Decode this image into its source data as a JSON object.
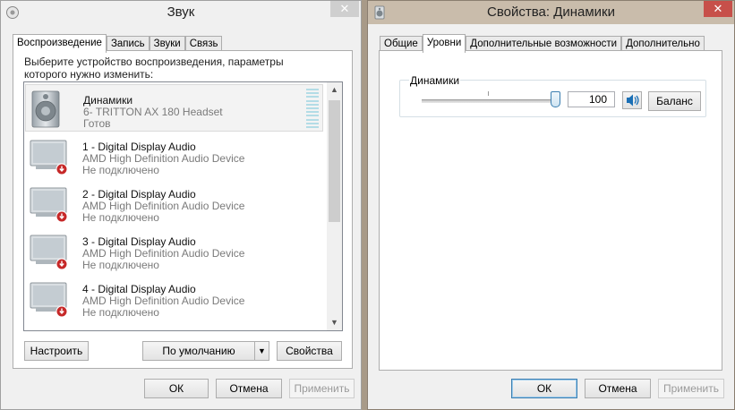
{
  "sound_window": {
    "title": "Звук",
    "close_glyph": "✕",
    "tabs": [
      {
        "label": "Воспроизведение"
      },
      {
        "label": "Запись"
      },
      {
        "label": "Звуки"
      },
      {
        "label": "Связь"
      }
    ],
    "description": "Выберите устройство воспроизведения, параметры которого нужно изменить:",
    "devices": [
      {
        "name": "Динамики",
        "sub": "6- TRITTON AX 180 Headset",
        "status": "Готов",
        "icon": "speaker-icon"
      },
      {
        "name": "1 - Digital Display Audio",
        "sub": "AMD High Definition Audio Device",
        "status": "Не подключено",
        "icon": "monitor-icon"
      },
      {
        "name": "2 - Digital Display Audio",
        "sub": "AMD High Definition Audio Device",
        "status": "Не подключено",
        "icon": "monitor-icon"
      },
      {
        "name": "3 - Digital Display Audio",
        "sub": "AMD High Definition Audio Device",
        "status": "Не подключено",
        "icon": "monitor-icon"
      },
      {
        "name": "4 - Digital Display Audio",
        "sub": "AMD High Definition Audio Device",
        "status": "Не подключено",
        "icon": "monitor-icon"
      }
    ],
    "configure_label": "Настроить",
    "default_label": "По умолчанию",
    "properties_label": "Свойства",
    "ok_label": "ОК",
    "cancel_label": "Отмена",
    "apply_label": "Применить"
  },
  "props_window": {
    "title": "Свойства: Динамики",
    "close_glyph": "✕",
    "tabs": [
      {
        "label": "Общие"
      },
      {
        "label": "Уровни"
      },
      {
        "label": "Дополнительные возможности"
      },
      {
        "label": "Дополнительно"
      }
    ],
    "active_tab": 1,
    "levels": {
      "group_label": "Динамики",
      "value": "100",
      "slider_fraction": 1.0,
      "balance_label": "Баланс"
    },
    "ok_label": "ОК",
    "cancel_label": "Отмена",
    "apply_label": "Применить"
  },
  "colors": {
    "accent": "#3c7fb1",
    "close_red": "#c7504a",
    "disconnected_badge": "#c62828"
  }
}
